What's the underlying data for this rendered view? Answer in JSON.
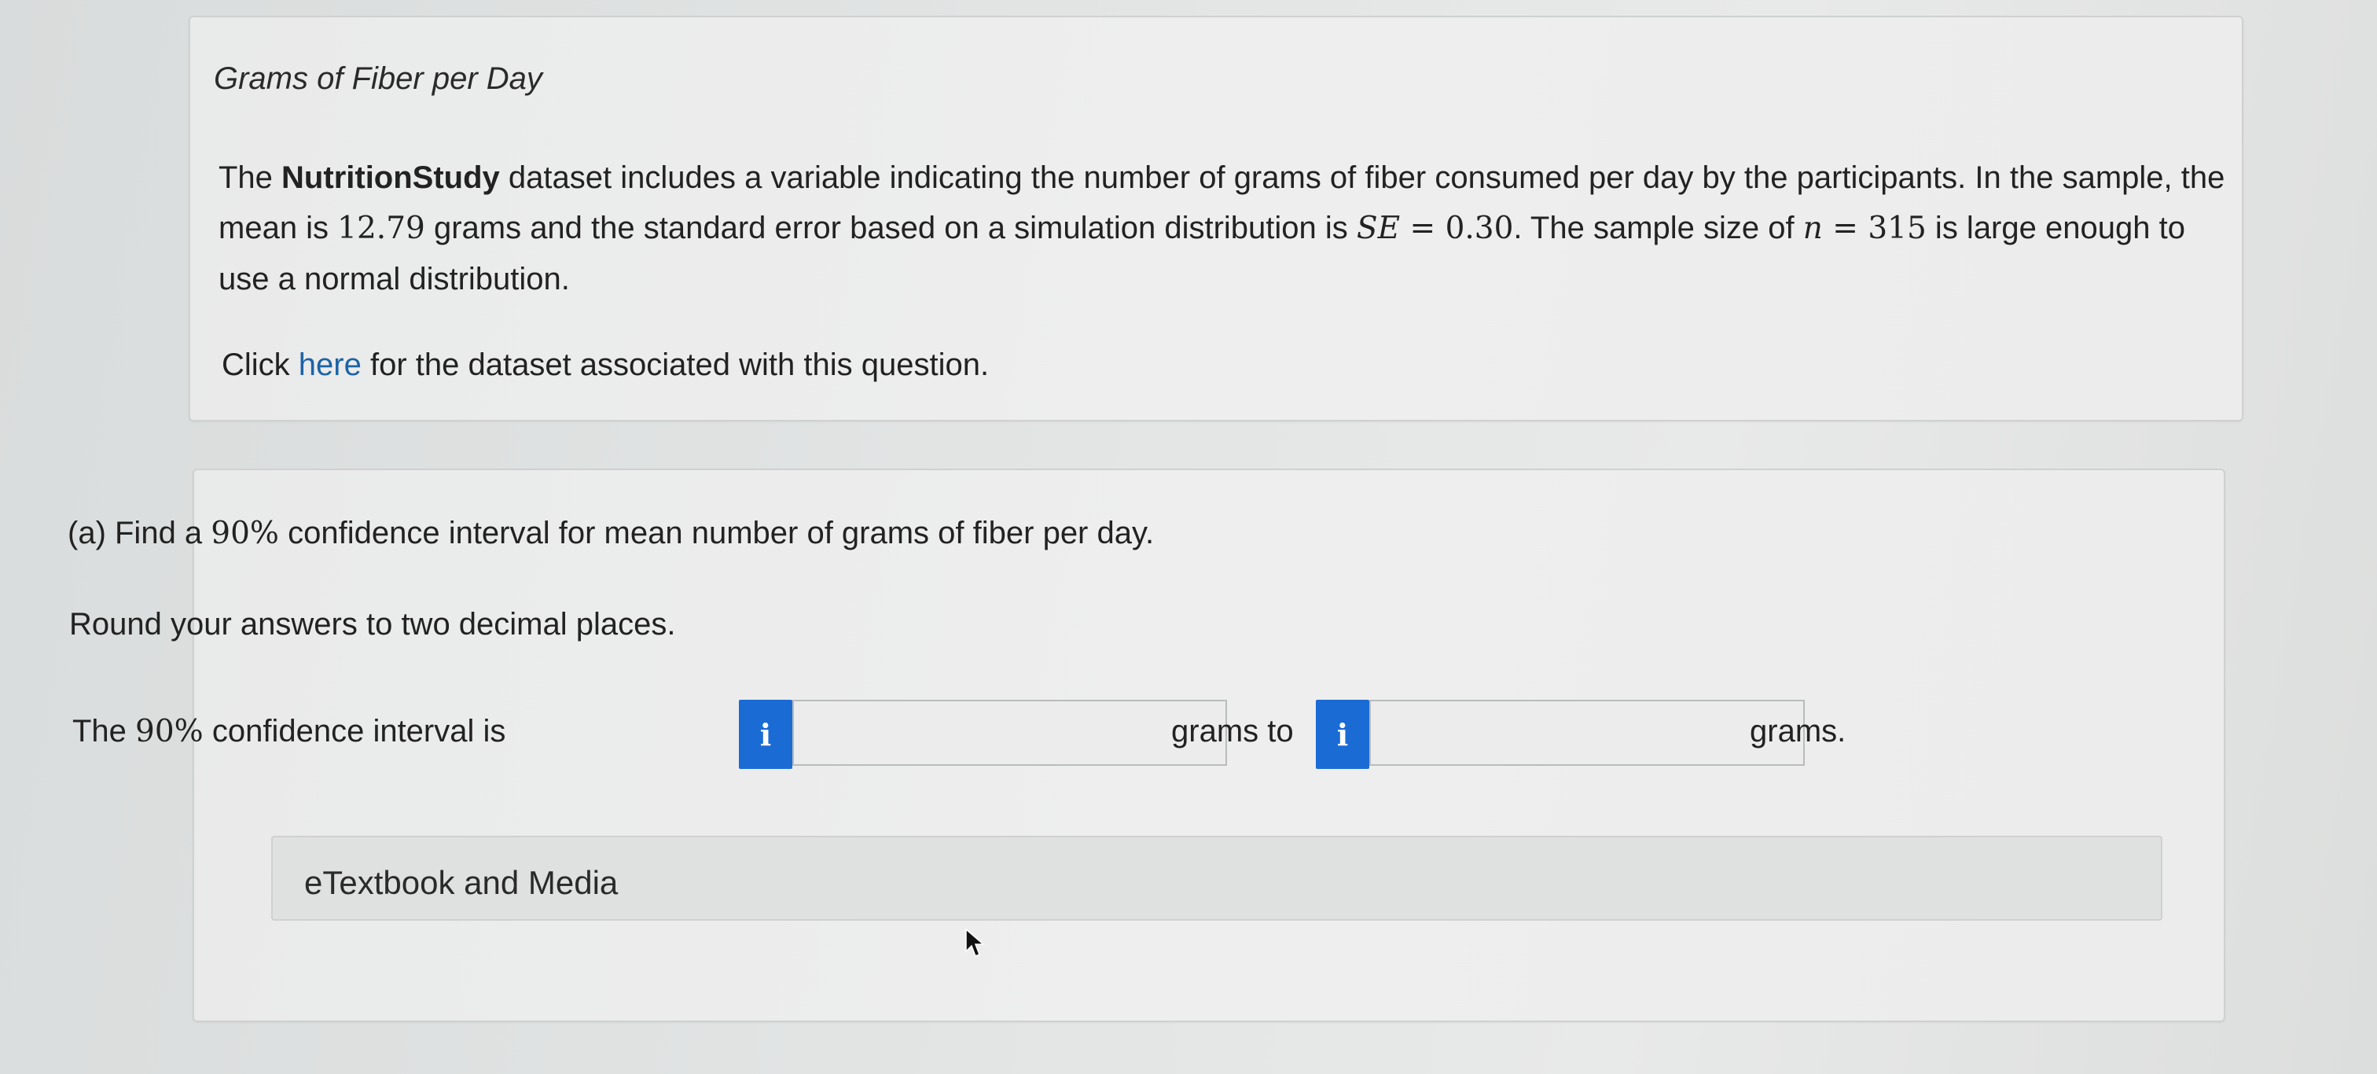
{
  "intro": {
    "title": "Grams of Fiber per Day",
    "text_1": "The ",
    "dataset_name": "NutritionStudy",
    "text_2": " dataset includes a variable indicating the number of grams of fiber consumed per day by the participants. In the sample, the mean is ",
    "mean_value": "12.79",
    "text_3": " grams and the standard error based on a simulation distribution is ",
    "se_symbol": "SE",
    "se_equals": " = ",
    "se_value": "0.30",
    "text_4": ". The sample size of ",
    "n_symbol": "n",
    "n_equals": " = ",
    "n_value": "315",
    "text_5": " is large enough to use a normal distribution.",
    "click_prefix": "Click ",
    "click_link": "here",
    "click_suffix": " for the dataset associated with this question."
  },
  "part_a": {
    "question_prefix": "(a) Find a ",
    "question_percent": "90%",
    "question_suffix": " confidence interval for mean number of grams of fiber per day.",
    "instruction": "Round your answers to two decimal places.",
    "interval_prefix": "The ",
    "interval_percent": "90%",
    "interval_suffix": " confidence interval is",
    "info_label": "i",
    "between_label": "grams to",
    "end_label": "grams.",
    "lower_value": "",
    "upper_value": ""
  },
  "etextbook": {
    "label": "eTextbook and Media"
  },
  "colors": {
    "info_button": "#1a6bd4",
    "link": "#1d63a6"
  }
}
